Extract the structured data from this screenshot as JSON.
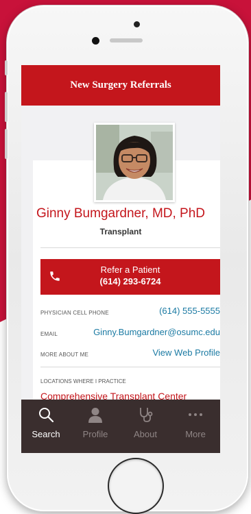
{
  "app": {
    "title": "New Surgery Referrals"
  },
  "profile": {
    "name": "Ginny Bumgardner, MD, PhD",
    "specialty": "Transplant",
    "photo_icon": "doctor-portrait"
  },
  "refer": {
    "label": "Refer a Patient",
    "phone": "(614) 293-6724",
    "icon": "phone-icon"
  },
  "details": [
    {
      "label": "PHYSICIAN CELL PHONE",
      "value": "(614) 555-5555"
    },
    {
      "label": "EMAIL",
      "value": "Ginny.Bumgardner@osumc.edu"
    },
    {
      "label": "MORE ABOUT ME",
      "value": "View Web Profile"
    }
  ],
  "locations": {
    "label": "LOCATIONS WHERE I PRACTICE",
    "items": [
      "Comprehensive Transplant Center"
    ]
  },
  "tabs": [
    {
      "label": "Search",
      "icon": "search-icon",
      "active": true
    },
    {
      "label": "Profile",
      "icon": "person-icon",
      "active": false
    },
    {
      "label": "About",
      "icon": "stethoscope-icon",
      "active": false
    },
    {
      "label": "More",
      "icon": "ellipsis-icon",
      "active": false
    }
  ],
  "colors": {
    "brand_red": "#c4161c",
    "link_blue": "#1b7aa3",
    "tabbar": "#3a2e2e",
    "background_red": "#c8123a"
  }
}
